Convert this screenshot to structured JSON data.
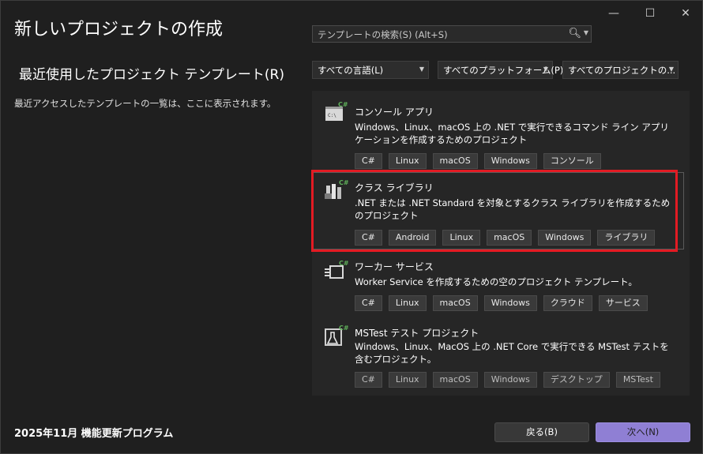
{
  "window": {
    "title": "新しいプロジェクトの作成",
    "controls": {
      "minimize": "—",
      "maximize": "☐",
      "close": "✕"
    }
  },
  "left": {
    "recent_heading": "最近使用したプロジェクト テンプレート(R)",
    "recent_desc": "最近アクセスしたテンプレートの一覧は、ここに表示されます。"
  },
  "search": {
    "placeholder": "テンプレートの検索(S) (Alt+S)",
    "icon": "search-icon"
  },
  "filters": {
    "language": "すべての言語(L)",
    "platform": "すべてのプラットフォーム(P)",
    "project_type": "すべてのプロジェクトの..."
  },
  "templates": [
    {
      "title": "コンソール アプリ",
      "desc": "Windows、Linux、macOS 上の .NET で実行できるコマンド ライン アプリケーションを作成するためのプロジェクト",
      "tags": [
        "C#",
        "Linux",
        "macOS",
        "Windows",
        "コンソール"
      ],
      "icon": "console-app-icon"
    },
    {
      "title": "クラス ライブラリ",
      "desc": ".NET または .NET Standard を対象とするクラス ライブラリを作成するためのプロジェクト",
      "tags": [
        "C#",
        "Android",
        "Linux",
        "macOS",
        "Windows",
        "ライブラリ"
      ],
      "icon": "class-library-icon",
      "selected": true
    },
    {
      "title": "ワーカー サービス",
      "desc": "Worker Service を作成するための空のプロジェクト テンプレート。",
      "tags": [
        "C#",
        "Linux",
        "macOS",
        "Windows",
        "クラウド",
        "サービス"
      ],
      "icon": "worker-service-icon"
    },
    {
      "title": "MSTest テスト プロジェクト",
      "desc": "Windows、Linux、MacOS 上の .NET Core で実行できる MSTest テストを含むプロジェクト。",
      "tags": [
        "C#",
        "Linux",
        "macOS",
        "Windows",
        "デスクトップ",
        "MSTest"
      ],
      "icon": "mstest-icon"
    }
  ],
  "footer": {
    "update_text": "2025年11月 機能更新プログラム",
    "back_label": "戻る(B)",
    "next_label": "次へ(N)"
  },
  "colors": {
    "accent": "#8f7fd4",
    "highlight": "#e31b23",
    "csharp": "#5fb05a"
  }
}
